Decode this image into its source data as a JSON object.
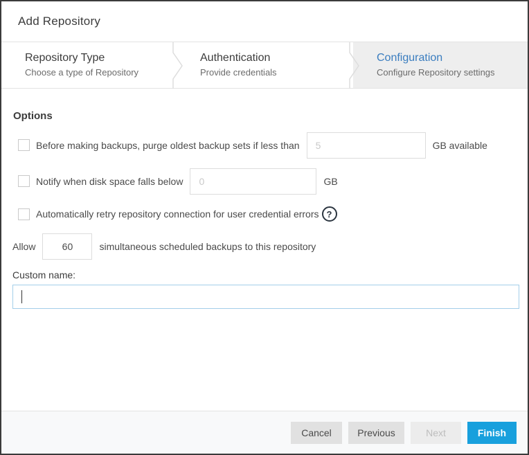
{
  "dialog": {
    "title": "Add Repository"
  },
  "stepper": {
    "steps": [
      {
        "title": "Repository Type",
        "subtitle": "Choose a type of Repository",
        "active": false
      },
      {
        "title": "Authentication",
        "subtitle": "Provide credentials",
        "active": false
      },
      {
        "title": "Configuration",
        "subtitle": "Configure Repository settings",
        "active": true
      }
    ]
  },
  "options": {
    "heading": "Options",
    "purge_row": {
      "label": "Before making backups, purge oldest backup sets if less than",
      "placeholder": "5",
      "suffix": "GB available",
      "checked": false
    },
    "notify_row": {
      "label": "Notify when disk space falls below",
      "placeholder": "0",
      "suffix": "GB",
      "checked": false
    },
    "retry_row": {
      "label": "Automatically retry repository connection for user credential errors",
      "help_icon": "question-circle-icon",
      "help_glyph": "?",
      "checked": false
    },
    "allow_row": {
      "prefix": "Allow",
      "value": "60",
      "suffix": "simultaneous scheduled backups to this repository"
    },
    "custom_name": {
      "label": "Custom name:",
      "value": ""
    }
  },
  "footer": {
    "buttons": [
      {
        "label": "Cancel",
        "enabled": true,
        "style": "default"
      },
      {
        "label": "Previous",
        "enabled": true,
        "style": "default"
      },
      {
        "label": "Next",
        "enabled": false,
        "style": "default"
      },
      {
        "label": "Finish",
        "enabled": true,
        "style": "primary"
      }
    ]
  },
  "colors": {
    "primary_button": "#18a0dd",
    "active_step_text": "#3a7dbf",
    "focused_input_border": "#a3cee9"
  }
}
